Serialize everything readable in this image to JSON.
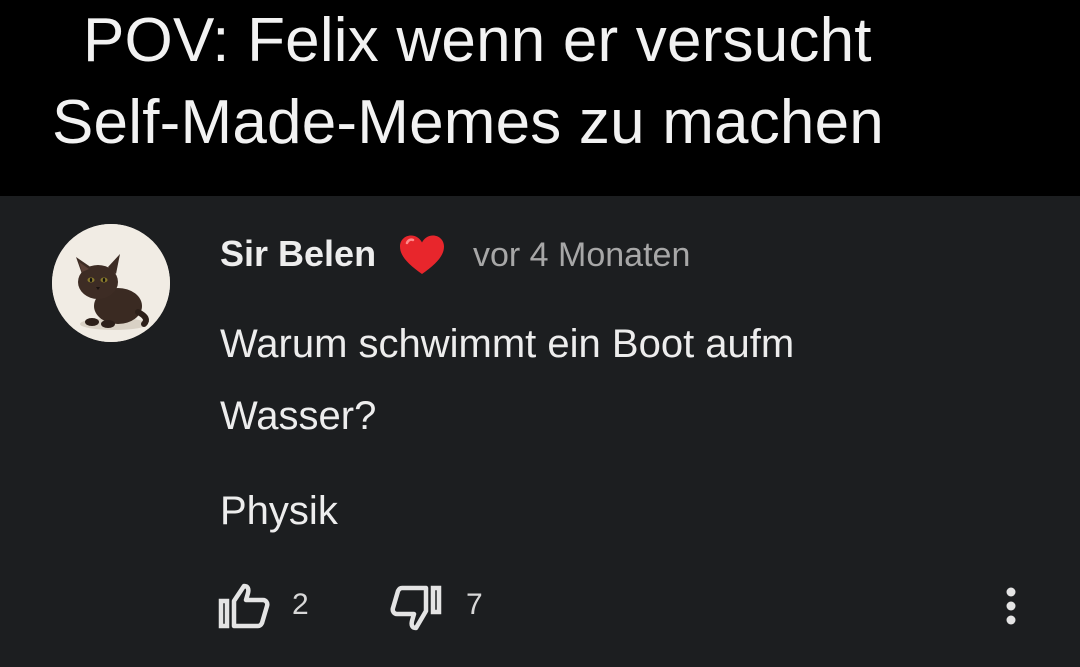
{
  "caption": {
    "line1": "POV: Felix wenn er versucht",
    "line2": "Self-Made-Memes zu machen"
  },
  "comment": {
    "author": "Sir Belen",
    "author_badge_icon": "heart-emoji-icon",
    "timestamp": "vor 4 Monaten",
    "text_line1": "Warum schwimmt ein Boot aufm",
    "text_line2": "Wasser?",
    "text_line3": "Physik",
    "likes": "2",
    "dislikes": "7",
    "icons": {
      "like": "thumbs-up-icon",
      "dislike": "thumbs-down-icon",
      "more": "more-vert-icon"
    }
  },
  "colors": {
    "caption_bg": "#000000",
    "comment_bg": "#1c1e20",
    "primary_text": "#ededed",
    "secondary_text": "#a7a7a7",
    "heart": "#e8262c"
  }
}
